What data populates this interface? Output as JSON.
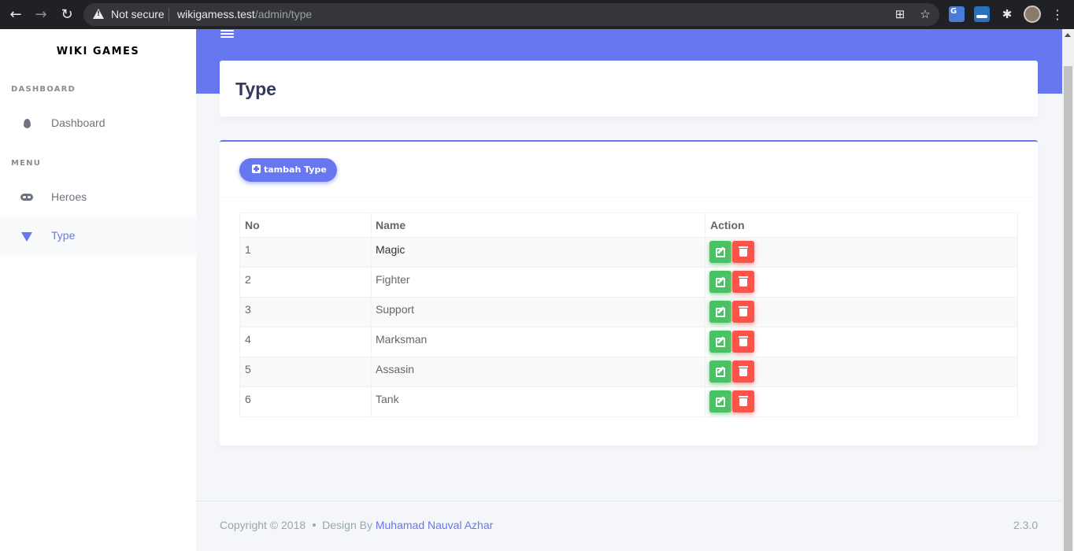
{
  "browser": {
    "security_label": "Not secure",
    "url_host": "wikigamess.test",
    "url_path": "/admin/type"
  },
  "sidebar": {
    "brand": "WIKI GAMES",
    "sections": [
      {
        "header": "DASHBOARD",
        "items": [
          {
            "label": "Dashboard",
            "icon": "fire-icon",
            "active": false
          }
        ]
      },
      {
        "header": "MENU",
        "items": [
          {
            "label": "Heroes",
            "icon": "mask-icon",
            "active": false
          },
          {
            "label": "Type",
            "icon": "vuejs-icon",
            "active": true
          }
        ]
      }
    ]
  },
  "page": {
    "title": "Type",
    "add_button_label": "tambah Type",
    "table": {
      "headers": [
        "No",
        "Name",
        "Action"
      ],
      "rows": [
        {
          "no": "1",
          "name": "Magic"
        },
        {
          "no": "2",
          "name": "Fighter"
        },
        {
          "no": "3",
          "name": "Support"
        },
        {
          "no": "4",
          "name": "Marksman"
        },
        {
          "no": "5",
          "name": "Assasin"
        },
        {
          "no": "6",
          "name": "Tank"
        }
      ]
    }
  },
  "footer": {
    "copyright": "Copyright © 2018",
    "design_by": "Design By",
    "author": "Muhamad Nauval Azhar",
    "version": "2.3.0"
  },
  "colors": {
    "primary": "#6777ef",
    "success": "#47c363",
    "danger": "#fc544b"
  }
}
